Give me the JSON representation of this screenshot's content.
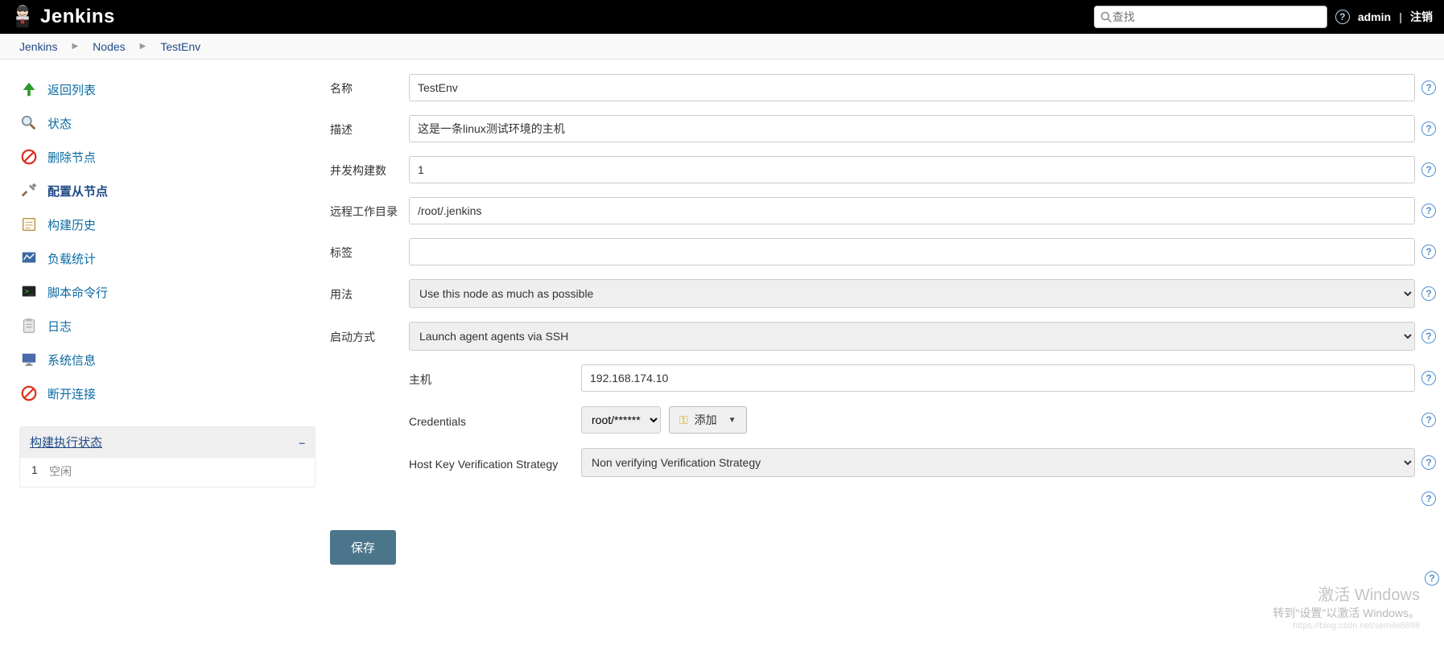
{
  "header": {
    "app_name": "Jenkins",
    "search_placeholder": "查找",
    "user": "admin",
    "logout": "注销"
  },
  "breadcrumb": {
    "items": [
      "Jenkins",
      "Nodes",
      "TestEnv"
    ]
  },
  "sidebar": {
    "items": [
      {
        "label": "返回列表",
        "icon": "arrow-up"
      },
      {
        "label": "状态",
        "icon": "magnifier"
      },
      {
        "label": "删除节点",
        "icon": "forbidden"
      },
      {
        "label": "配置从节点",
        "icon": "tools",
        "active": true
      },
      {
        "label": "构建历史",
        "icon": "notepad"
      },
      {
        "label": "负载统计",
        "icon": "monitor-chart"
      },
      {
        "label": "脚本命令行",
        "icon": "terminal"
      },
      {
        "label": "日志",
        "icon": "clipboard"
      },
      {
        "label": "系统信息",
        "icon": "computer"
      },
      {
        "label": "断开连接",
        "icon": "forbidden"
      }
    ],
    "exec": {
      "title": "构建执行状态",
      "rows": [
        {
          "num": "1",
          "state": "空闲"
        }
      ]
    }
  },
  "form": {
    "name_label": "名称",
    "name_value": "TestEnv",
    "desc_label": "描述",
    "desc_value": "这是一条linux测试环境的主机",
    "executors_label": "并发构建数",
    "executors_value": "1",
    "remotefs_label": "远程工作目录",
    "remotefs_value": "/root/.jenkins",
    "labels_label": "标签",
    "labels_value": "",
    "usage_label": "用法",
    "usage_value": "Use this node as much as possible",
    "launch_label": "启动方式",
    "launch_value": "Launch agent agents via SSH",
    "ssh": {
      "host_label": "主机",
      "host_value": "192.168.174.10",
      "cred_label": "Credentials",
      "cred_value": "root/******",
      "add_label": "添加",
      "hkvs_label": "Host Key Verification Strategy",
      "hkvs_value": "Non verifying Verification Strategy"
    },
    "save_label": "保存"
  },
  "watermark": {
    "line1": "激活 Windows",
    "line2": "转到\"设置\"以激活 Windows。",
    "line3": "https://blog.csdn.net/semile6898"
  }
}
